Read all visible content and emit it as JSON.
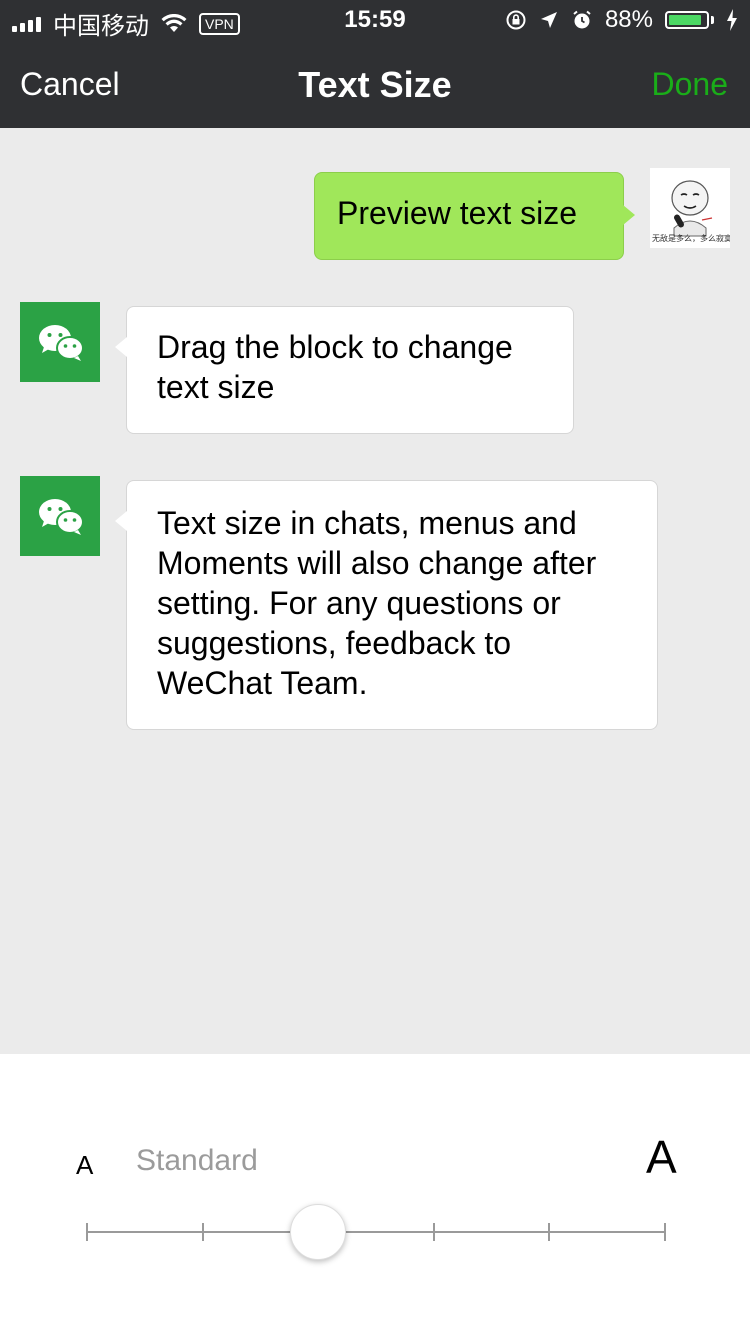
{
  "status": {
    "carrier": "中国移动",
    "vpn": "VPN",
    "time": "15:59",
    "battery_text": "88%",
    "battery_level": 0.88,
    "battery_color": "#4cd964"
  },
  "nav": {
    "cancel": "Cancel",
    "title": "Text Size",
    "done": "Done",
    "done_color": "#1aad19"
  },
  "messages": [
    {
      "side": "me",
      "text": "Preview text size"
    },
    {
      "side": "other",
      "text": "Drag the block to change text size"
    },
    {
      "side": "other",
      "text": "Text size in chats, menus and Moments will also change after setting. For any questions or suggestions, feedback to WeChat Team."
    }
  ],
  "avatar_me_caption": "无敌是多么，多么寂寞",
  "slider": {
    "small_label": "A",
    "current_label": "Standard",
    "large_label": "A",
    "steps": 6,
    "selected_index": 2
  },
  "icons": {
    "wifi": "wifi-icon",
    "lock": "orientation-lock-icon",
    "location": "location-arrow-icon",
    "alarm": "alarm-icon",
    "charging": "charging-bolt-icon",
    "wechat": "wechat-logo-icon"
  }
}
